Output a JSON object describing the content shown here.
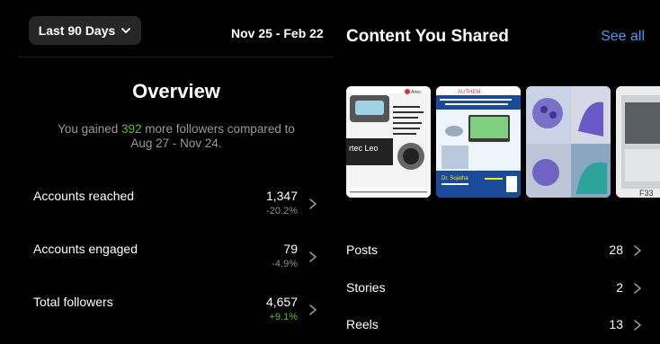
{
  "range": {
    "label": "Last 90 Days",
    "dates": "Nov 25 - Feb 22"
  },
  "overview": {
    "title": "Overview",
    "gained_prefix": "You gained",
    "gained_count": "392",
    "gained_suffix": "more followers compared to",
    "gained_range": "Aug 27 - Nov 24."
  },
  "metrics": [
    {
      "label": "Accounts reached",
      "value": "1,347",
      "change": "-20.2%"
    },
    {
      "label": "Accounts engaged",
      "value": "79",
      "change": "-4.9%"
    },
    {
      "label": "Total followers",
      "value": "4,657",
      "change": "+9.1%"
    }
  ],
  "content": {
    "title": "Content You Shared",
    "see_all": "See all",
    "thumbnails": [
      {
        "caption": "rtec Leo",
        "header": "Artec"
      },
      {
        "caption": "Dr. Sujatha",
        "header": "AUTHEM"
      },
      {
        "caption": ""
      },
      {
        "caption": "F33"
      }
    ],
    "rows": [
      {
        "label": "Posts",
        "count": "28"
      },
      {
        "label": "Stories",
        "count": "2"
      },
      {
        "label": "Reels",
        "count": "13"
      }
    ]
  },
  "colors": {
    "link": "#3d9df3",
    "positive": "#4cc427",
    "pill": "#262626"
  }
}
